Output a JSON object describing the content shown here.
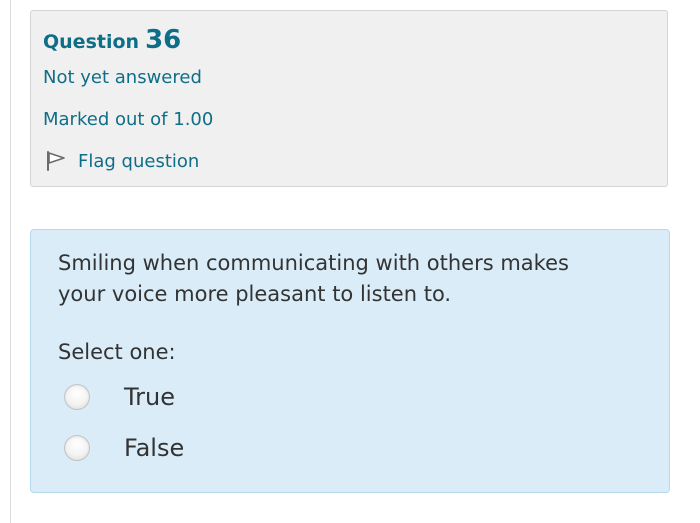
{
  "question_info": {
    "label": "Question",
    "number": "36",
    "status": "Not yet answered",
    "marks": "Marked out of 1.00",
    "flag_label": "Flag question"
  },
  "question": {
    "text": "Smiling when communicating with others makes your voice more pleasant to listen to.",
    "prompt": "Select one:",
    "options": [
      {
        "label": "True",
        "selected": false
      },
      {
        "label": "False",
        "selected": false
      }
    ]
  },
  "colors": {
    "link_teal": "#0f6e87",
    "info_background": "#f0f0f0",
    "content_background": "#d9ecf7",
    "content_border": "#b5d9ee",
    "body_text": "#333333"
  },
  "icons": {
    "flag": "flag-icon",
    "radio": "radio-button"
  }
}
